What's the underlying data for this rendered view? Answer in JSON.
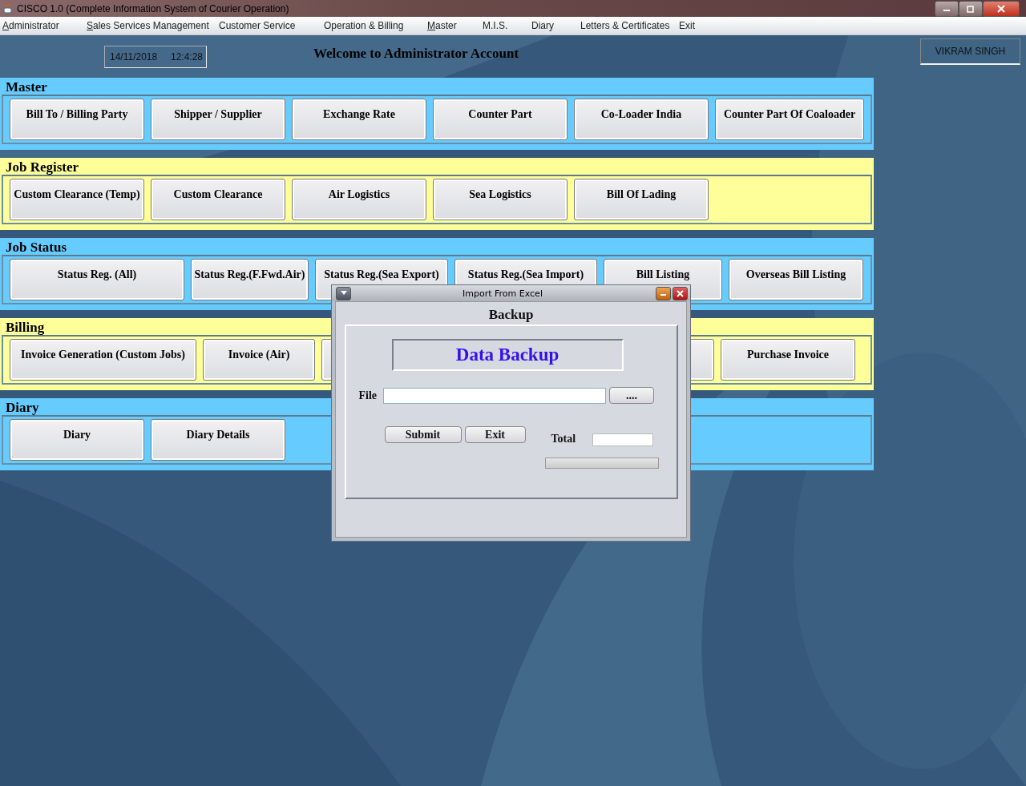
{
  "window": {
    "title": "CISCO 1.0 (Complete Information System of Courier Operation)"
  },
  "menu": [
    {
      "label": "Administrator",
      "underlined": true
    },
    {
      "label": "Sales Services Management",
      "underlined": true
    },
    {
      "label": "Customer Service",
      "underlined": false
    },
    {
      "label": "Operation & Billing",
      "underlined": false
    },
    {
      "label": "Master",
      "underlined": true
    },
    {
      "label": "M.I.S.",
      "underlined": false
    },
    {
      "label": "Diary",
      "underlined": false
    },
    {
      "label": "Letters & Certificates",
      "underlined": false
    },
    {
      "label": "Exit",
      "underlined": false
    }
  ],
  "date": "14/11/2018",
  "time": "12:4:28",
  "welcome": "Welcome to Administrator Account",
  "user": "VIKRAM SINGH",
  "sections": [
    {
      "title": "Master",
      "color": "#66ccff",
      "buttons": [
        {
          "label": "Bill To / Billing Party"
        },
        {
          "label": "Shipper / Supplier"
        },
        {
          "label": "Exchange Rate"
        },
        {
          "label": "Counter Part"
        },
        {
          "label": "Co-Loader India"
        },
        {
          "label": "Counter Part Of Coaloader"
        }
      ]
    },
    {
      "title": "Job Register",
      "color": "#ffff99",
      "buttons": [
        {
          "label": "Custom Clearance (Temp)"
        },
        {
          "label": "Custom Clearance"
        },
        {
          "label": "Air Logistics"
        },
        {
          "label": "Sea Logistics"
        },
        {
          "label": "Bill Of Lading"
        }
      ]
    },
    {
      "title": "Job Status",
      "color": "#66ccff",
      "buttons": [
        {
          "label": "Status Reg. (All)"
        },
        {
          "label": "Status Reg.(F.Fwd.Air)"
        },
        {
          "label": "Status Reg.(Sea Export)"
        },
        {
          "label": "Status Reg.(Sea Import)"
        },
        {
          "label": "Bill Listing"
        },
        {
          "label": "Overseas Bill Listing"
        }
      ]
    },
    {
      "title": "Billing",
      "color": "#ffff99",
      "buttons": [
        {
          "label": "Invoice Generation (Custom Jobs)"
        },
        {
          "label": "Invoice (Air)"
        },
        {
          "kind": "covered"
        },
        {
          "kind": "covered"
        },
        {
          "label": "Purchase Invoice"
        }
      ]
    },
    {
      "title": "Diary",
      "color": "#66ccff",
      "buttons": [
        {
          "label": "Diary"
        },
        {
          "label": "Diary Details"
        }
      ]
    }
  ],
  "dialog": {
    "title": "Import From Excel",
    "heading": "Backup",
    "banner": "Data Backup",
    "file_label": "File",
    "browse": "....",
    "submit": "Submit",
    "exit": "Exit",
    "total_label": "Total",
    "level": 0
  }
}
